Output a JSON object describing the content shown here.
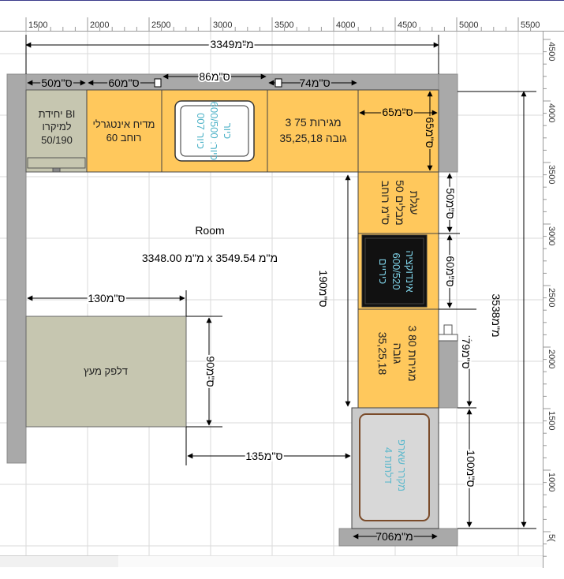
{
  "ruler_top": {
    "ticks": [
      "1500",
      "2000",
      "2500",
      "3000",
      "3500",
      "4000",
      "4500",
      "5000",
      "5500"
    ]
  },
  "ruler_right": {
    "ticks": [
      "4500",
      "4000",
      "3500",
      "3000",
      "2500",
      "2000",
      "1500",
      "1000",
      "5("
    ]
  },
  "room": {
    "name": "Room",
    "size": "3348.00 מ\"מ x 3549.54 מ\"מ"
  },
  "dimensions": {
    "total_width": "מ\"מ3349",
    "total_height": "מ\"מ3538",
    "top_50": "ס\"מ50",
    "top_60": "ס\"מ60",
    "top_86": "ס\"מ86",
    "top_74": "ס\"מ74",
    "corner_65": "ס\"מ65",
    "corner_65v": "ס\"מ65",
    "right_50": "ס\"מ50",
    "right_60": "ס\"מ60",
    "left_run_190": "ס\"מ190",
    "right_79": "ס\"מ79",
    "right_100": "ס\"מ100",
    "table_130": "ס\"מ130",
    "table_90": "ס\"מ90",
    "gap_135": "ס\"מ135",
    "fridge_706": "מ\"מ706"
  },
  "cabinets": {
    "micro_unit": [
      "יחידת BI",
      "למיקרו",
      "50/190"
    ],
    "dishwasher": [
      "מדיח אינטגרלי",
      "רוחב 60"
    ],
    "sink": [
      "כיור",
      "600/500 :כיור",
      "כיור 007"
    ],
    "drawers_75": [
      "3 מגירות 75",
      "35,25,18 גובה"
    ],
    "pullout": [
      "עגלת",
      "מבלים 50",
      "ס\"מ רוחב"
    ],
    "cooktop": [
      "אינדוקציה",
      "600/520",
      "כיריים"
    ],
    "drawers_80": [
      "3 מגירות 80",
      "גובה",
      "35,25,18"
    ],
    "fridge": [
      "מקרר שארפ",
      "4 דלתות"
    ],
    "table": "דלפק מעץ"
  },
  "colors": {
    "counter": "#ffc85c",
    "wall": "#a9a9a9",
    "table": "#c6c6b0",
    "sink_text": "#4fb3c8",
    "cooktop_text": "#7fd3e8",
    "fridge_text": "#5fb9cc",
    "dim_line": "#000000"
  }
}
